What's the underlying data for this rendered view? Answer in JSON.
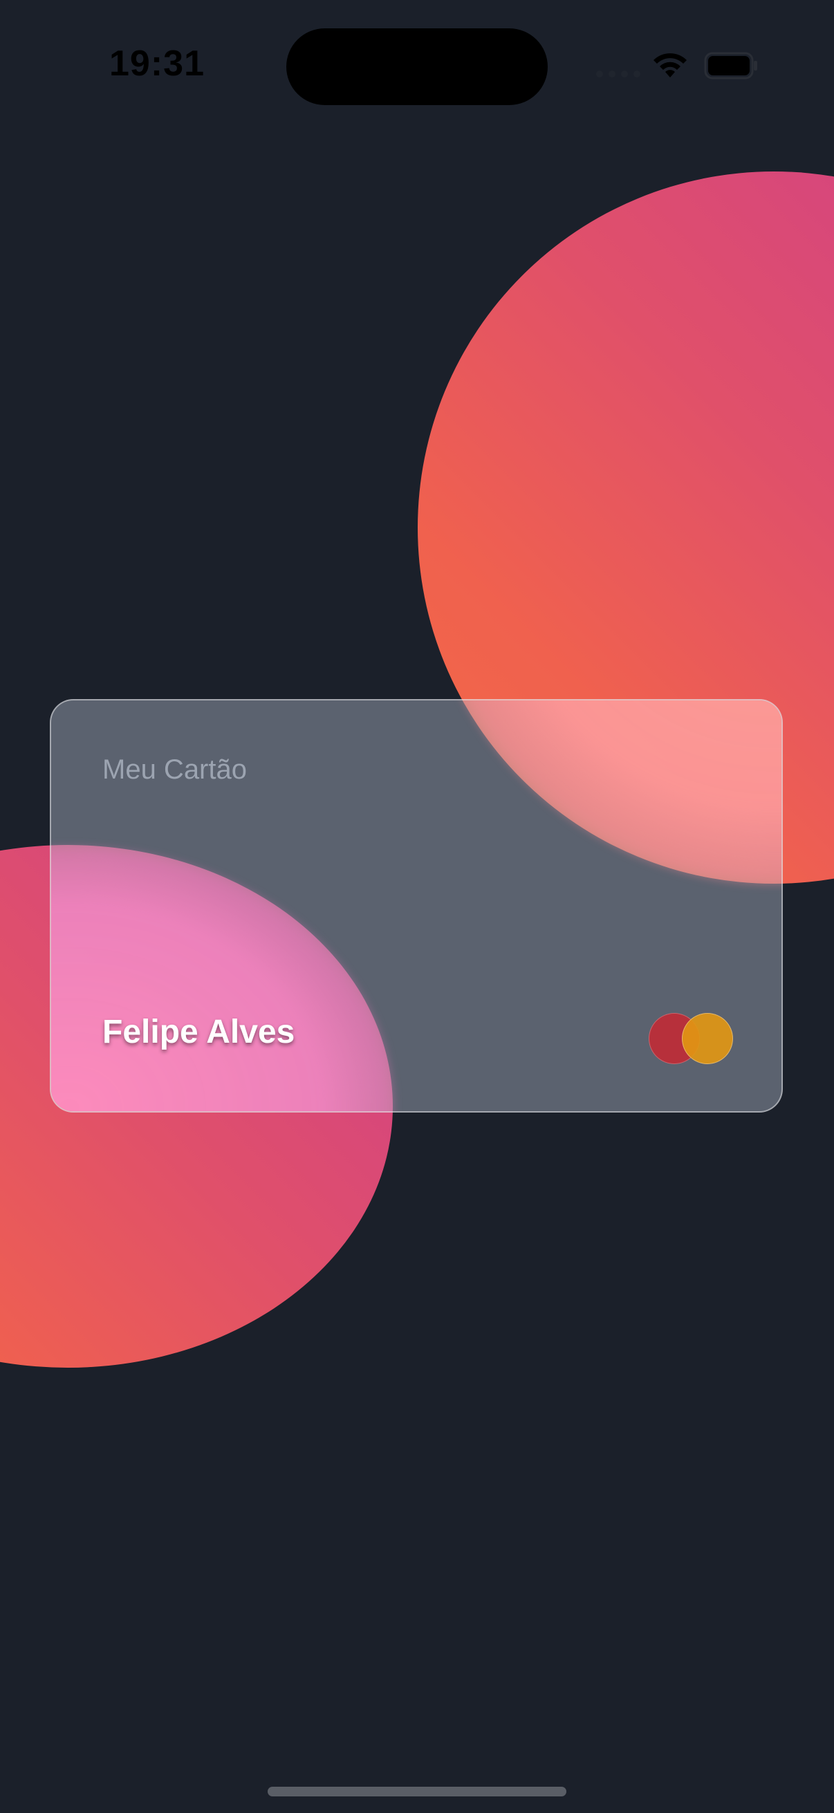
{
  "status_bar": {
    "time": "19:31"
  },
  "card": {
    "title": "Meu Cartão",
    "holder_name": "Felipe Alves",
    "network_logo": "mastercard-logo-icon"
  },
  "colors": {
    "background": "#1b202a",
    "blob_gradient_start": "#cf3f8a",
    "blob_gradient_end": "#f36a45",
    "logo_red": "#b7303b",
    "logo_orange": "#e19614"
  },
  "icons": {
    "wifi": "wifi-icon",
    "battery": "battery-icon",
    "signal": "cellular-signal-icon"
  }
}
